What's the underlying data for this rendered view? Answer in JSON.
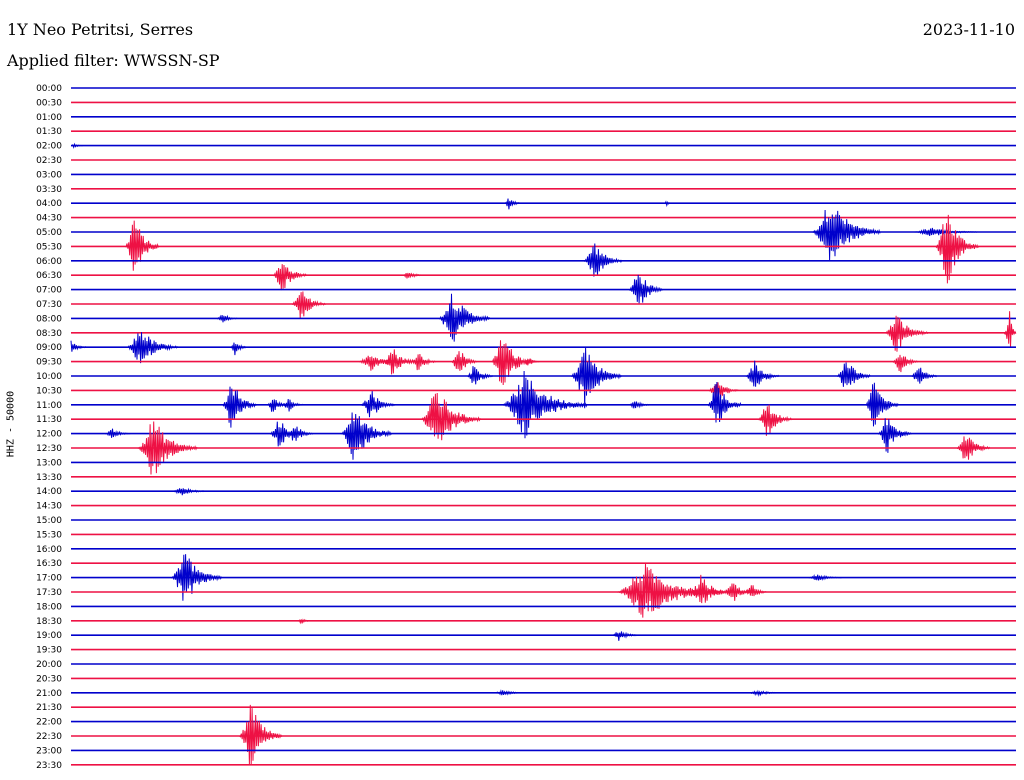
{
  "header": {
    "station": "1Y Neo Petritsi, Serres",
    "date": "2023-11-10",
    "filter": "Applied filter: WWSSN-SP"
  },
  "colors": {
    "blue": "#0000cc",
    "red": "#ee1144"
  },
  "chart_data": {
    "type": "line",
    "ylabel": "HHZ - 50000",
    "rows": [
      "00:00",
      "00:30",
      "01:00",
      "01:30",
      "02:00",
      "02:30",
      "03:00",
      "03:30",
      "04:00",
      "04:30",
      "05:00",
      "05:30",
      "06:00",
      "06:30",
      "07:00",
      "07:30",
      "08:00",
      "08:30",
      "09:00",
      "09:30",
      "10:00",
      "10:30",
      "11:00",
      "11:30",
      "12:00",
      "12:30",
      "13:00",
      "13:30",
      "14:00",
      "14:30",
      "15:00",
      "15:30",
      "16:00",
      "16:30",
      "17:00",
      "17:30",
      "18:00",
      "18:30",
      "19:00",
      "19:30",
      "20:00",
      "20:30",
      "21:00",
      "21:30",
      "22:00",
      "22:30",
      "23:00",
      "23:30"
    ],
    "row_minutes": 30,
    "events": [
      {
        "row": "02:00",
        "minute": 0.1,
        "amp": 0.15,
        "dur": 0.3
      },
      {
        "row": "04:00",
        "minute": 13.9,
        "amp": 0.5,
        "dur": 0.4
      },
      {
        "row": "04:00",
        "minute": 18.9,
        "amp": 0.2,
        "dur": 0.2
      },
      {
        "row": "05:00",
        "minute": 24.1,
        "amp": 2.7,
        "dur": 1.6
      },
      {
        "row": "05:00",
        "minute": 27.3,
        "amp": 0.4,
        "dur": 1.5
      },
      {
        "row": "05:30",
        "minute": 2.0,
        "amp": 2.6,
        "dur": 0.8
      },
      {
        "row": "05:30",
        "minute": 27.8,
        "amp": 3.2,
        "dur": 1.0
      },
      {
        "row": "06:00",
        "minute": 16.6,
        "amp": 1.6,
        "dur": 0.9
      },
      {
        "row": "06:30",
        "minute": 6.7,
        "amp": 1.4,
        "dur": 0.8
      },
      {
        "row": "06:30",
        "minute": 10.7,
        "amp": 0.4,
        "dur": 0.5
      },
      {
        "row": "07:00",
        "minute": 18.0,
        "amp": 1.8,
        "dur": 0.8
      },
      {
        "row": "07:30",
        "minute": 7.3,
        "amp": 1.3,
        "dur": 0.8
      },
      {
        "row": "08:00",
        "minute": 4.8,
        "amp": 0.4,
        "dur": 0.5
      },
      {
        "row": "08:00",
        "minute": 12.1,
        "amp": 2.2,
        "dur": 1.2
      },
      {
        "row": "08:30",
        "minute": 26.2,
        "amp": 1.6,
        "dur": 1.0
      },
      {
        "row": "08:30",
        "minute": 29.8,
        "amp": 1.6,
        "dur": 0.5
      },
      {
        "row": "09:00",
        "minute": 0.0,
        "amp": 0.5,
        "dur": 0.5
      },
      {
        "row": "09:00",
        "minute": 2.2,
        "amp": 1.6,
        "dur": 1.2
      },
      {
        "row": "09:00",
        "minute": 5.2,
        "amp": 0.6,
        "dur": 0.4
      },
      {
        "row": "09:30",
        "minute": 9.5,
        "amp": 0.8,
        "dur": 1.0
      },
      {
        "row": "09:30",
        "minute": 10.2,
        "amp": 1.2,
        "dur": 0.8
      },
      {
        "row": "09:30",
        "minute": 11.0,
        "amp": 0.9,
        "dur": 0.6
      },
      {
        "row": "09:30",
        "minute": 12.3,
        "amp": 1.3,
        "dur": 0.6
      },
      {
        "row": "09:30",
        "minute": 13.7,
        "amp": 2.3,
        "dur": 1.0
      },
      {
        "row": "09:30",
        "minute": 14.5,
        "amp": 0.3,
        "dur": 0.4
      },
      {
        "row": "09:30",
        "minute": 26.3,
        "amp": 1.0,
        "dur": 0.6
      },
      {
        "row": "10:00",
        "minute": 12.8,
        "amp": 1.0,
        "dur": 0.6
      },
      {
        "row": "10:00",
        "minute": 16.3,
        "amp": 2.5,
        "dur": 1.2
      },
      {
        "row": "10:00",
        "minute": 21.7,
        "amp": 1.2,
        "dur": 0.8
      },
      {
        "row": "10:00",
        "minute": 24.6,
        "amp": 1.5,
        "dur": 0.8
      },
      {
        "row": "10:00",
        "minute": 26.9,
        "amp": 0.9,
        "dur": 0.6
      },
      {
        "row": "10:30",
        "minute": 20.5,
        "amp": 1.0,
        "dur": 0.7
      },
      {
        "row": "11:00",
        "minute": 5.1,
        "amp": 2.2,
        "dur": 0.8
      },
      {
        "row": "11:00",
        "minute": 6.4,
        "amp": 0.7,
        "dur": 0.5
      },
      {
        "row": "11:00",
        "minute": 6.9,
        "amp": 0.6,
        "dur": 0.5
      },
      {
        "row": "11:00",
        "minute": 9.5,
        "amp": 1.3,
        "dur": 0.8
      },
      {
        "row": "11:00",
        "minute": 14.4,
        "amp": 2.5,
        "dur": 2.0
      },
      {
        "row": "11:00",
        "minute": 17.9,
        "amp": 0.4,
        "dur": 0.5
      },
      {
        "row": "11:00",
        "minute": 20.5,
        "amp": 2.0,
        "dur": 0.8
      },
      {
        "row": "11:00",
        "minute": 25.5,
        "amp": 2.0,
        "dur": 0.8
      },
      {
        "row": "11:30",
        "minute": 11.6,
        "amp": 2.6,
        "dur": 1.4
      },
      {
        "row": "11:30",
        "minute": 22.1,
        "amp": 1.6,
        "dur": 0.8
      },
      {
        "row": "12:00",
        "minute": 1.3,
        "amp": 0.4,
        "dur": 0.6
      },
      {
        "row": "12:00",
        "minute": 6.6,
        "amp": 1.2,
        "dur": 0.8
      },
      {
        "row": "12:00",
        "minute": 7.1,
        "amp": 0.9,
        "dur": 0.6
      },
      {
        "row": "12:00",
        "minute": 9.0,
        "amp": 2.3,
        "dur": 1.2
      },
      {
        "row": "12:00",
        "minute": 25.9,
        "amp": 1.6,
        "dur": 0.8
      },
      {
        "row": "12:30",
        "minute": 2.6,
        "amp": 2.4,
        "dur": 1.4
      },
      {
        "row": "12:30",
        "minute": 28.4,
        "amp": 1.3,
        "dur": 0.8
      },
      {
        "row": "14:00",
        "minute": 3.5,
        "amp": 0.4,
        "dur": 0.8
      },
      {
        "row": "17:00",
        "minute": 3.6,
        "amp": 2.2,
        "dur": 1.2
      },
      {
        "row": "17:00",
        "minute": 23.7,
        "amp": 0.3,
        "dur": 0.8
      },
      {
        "row": "17:30",
        "minute": 18.2,
        "amp": 2.2,
        "dur": 2.5
      },
      {
        "row": "17:30",
        "minute": 20.0,
        "amp": 1.3,
        "dur": 1.0
      },
      {
        "row": "17:30",
        "minute": 21.0,
        "amp": 0.9,
        "dur": 0.7
      },
      {
        "row": "17:30",
        "minute": 21.6,
        "amp": 0.7,
        "dur": 0.5
      },
      {
        "row": "18:30",
        "minute": 7.3,
        "amp": 0.3,
        "dur": 0.3
      },
      {
        "row": "19:00",
        "minute": 17.4,
        "amp": 0.5,
        "dur": 0.6
      },
      {
        "row": "21:00",
        "minute": 13.7,
        "amp": 0.2,
        "dur": 0.8
      },
      {
        "row": "21:00",
        "minute": 21.8,
        "amp": 0.2,
        "dur": 0.8
      },
      {
        "row": "22:30",
        "minute": 5.7,
        "amp": 2.7,
        "dur": 1.0
      }
    ]
  }
}
